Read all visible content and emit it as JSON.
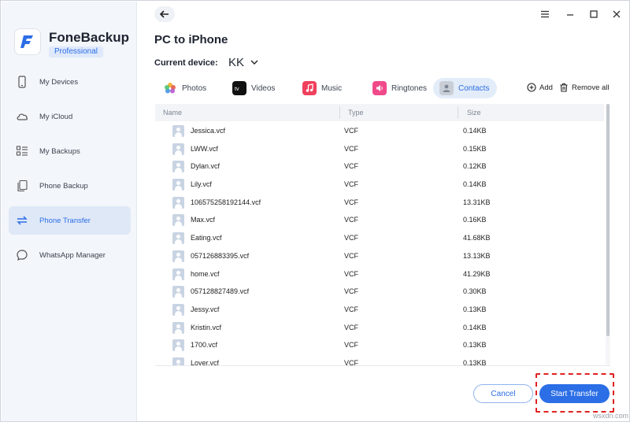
{
  "app": {
    "name": "FoneBackup",
    "edition": "Professional"
  },
  "sidebar": {
    "items": [
      {
        "label": "My Devices",
        "icon": "phone-icon",
        "active": false
      },
      {
        "label": "My iCloud",
        "icon": "cloud-icon",
        "active": false
      },
      {
        "label": "My Backups",
        "icon": "backups-icon",
        "active": false
      },
      {
        "label": "Phone Backup",
        "icon": "phone-backup-icon",
        "active": false
      },
      {
        "label": "Phone Transfer",
        "icon": "transfer-icon",
        "active": true
      },
      {
        "label": "WhatsApp Manager",
        "icon": "chat-icon",
        "active": false
      }
    ]
  },
  "header": {
    "title": "PC to iPhone",
    "device_label": "Current device:",
    "device_name": "KK"
  },
  "tabs": [
    {
      "label": "Photos",
      "icon": "photos-icon",
      "active": false
    },
    {
      "label": "Videos",
      "icon": "appletv-icon",
      "active": false
    },
    {
      "label": "Music",
      "icon": "music-icon",
      "active": false
    },
    {
      "label": "Ringtones",
      "icon": "ringtones-icon",
      "active": false
    },
    {
      "label": "Contacts",
      "icon": "contacts-icon",
      "active": true
    }
  ],
  "actions": {
    "add": "Add",
    "remove_all": "Remove all"
  },
  "table": {
    "columns": [
      "Name",
      "Type",
      "Size"
    ],
    "rows": [
      {
        "name": "Jessica.vcf",
        "type": "VCF",
        "size": "0.14KB"
      },
      {
        "name": "LWW.vcf",
        "type": "VCF",
        "size": "0.15KB"
      },
      {
        "name": "Dylan.vcf",
        "type": "VCF",
        "size": "0.12KB"
      },
      {
        "name": "Lily.vcf",
        "type": "VCF",
        "size": "0.14KB"
      },
      {
        "name": "106575258192144.vcf",
        "type": "VCF",
        "size": "13.31KB"
      },
      {
        "name": "Max.vcf",
        "type": "VCF",
        "size": "0.16KB"
      },
      {
        "name": "Eating.vcf",
        "type": "VCF",
        "size": "41.68KB"
      },
      {
        "name": "057126883395.vcf",
        "type": "VCF",
        "size": "13.13KB"
      },
      {
        "name": "home.vcf",
        "type": "VCF",
        "size": "41.29KB"
      },
      {
        "name": "057128827489.vcf",
        "type": "VCF",
        "size": "0.30KB"
      },
      {
        "name": "Jessy.vcf",
        "type": "VCF",
        "size": "0.13KB"
      },
      {
        "name": "Kristin.vcf",
        "type": "VCF",
        "size": "0.14KB"
      },
      {
        "name": "1700.vcf",
        "type": "VCF",
        "size": "0.13KB"
      },
      {
        "name": "Lover.vcf",
        "type": "VCF",
        "size": "0.13KB"
      }
    ]
  },
  "footer": {
    "cancel": "Cancel",
    "start": "Start Transfer"
  },
  "watermark": "wsxdn.com",
  "colors": {
    "accent": "#2b6ee6",
    "highlight": "#e02020",
    "sidebar_bg": "#f3f6fa"
  }
}
